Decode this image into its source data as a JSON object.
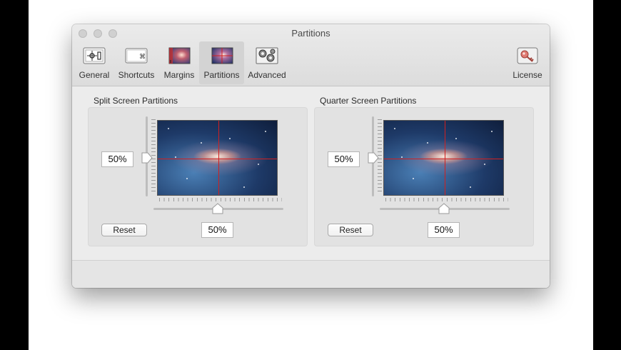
{
  "window": {
    "title": "Partitions"
  },
  "toolbar": {
    "items": [
      {
        "label": "General",
        "icon": "general-icon"
      },
      {
        "label": "Shortcuts",
        "icon": "keyboard-icon"
      },
      {
        "label": "Margins",
        "icon": "margins-icon"
      },
      {
        "label": "Partitions",
        "icon": "partitions-icon",
        "selected": true
      },
      {
        "label": "Advanced",
        "icon": "gears-icon"
      }
    ],
    "license": {
      "label": "License",
      "icon": "key-icon"
    }
  },
  "split": {
    "title": "Split Screen Partitions",
    "vertical_value": "50%",
    "horizontal_value": "50%",
    "vertical_fraction": 0.5,
    "horizontal_fraction": 0.5,
    "reset_label": "Reset"
  },
  "quarter": {
    "title": "Quarter Screen Partitions",
    "vertical_value": "50%",
    "horizontal_value": "50%",
    "vertical_fraction": 0.5,
    "horizontal_fraction": 0.5,
    "reset_label": "Reset"
  },
  "colors": {
    "partition_line": "#d02020",
    "selected_tab": "#d3d3d3"
  }
}
